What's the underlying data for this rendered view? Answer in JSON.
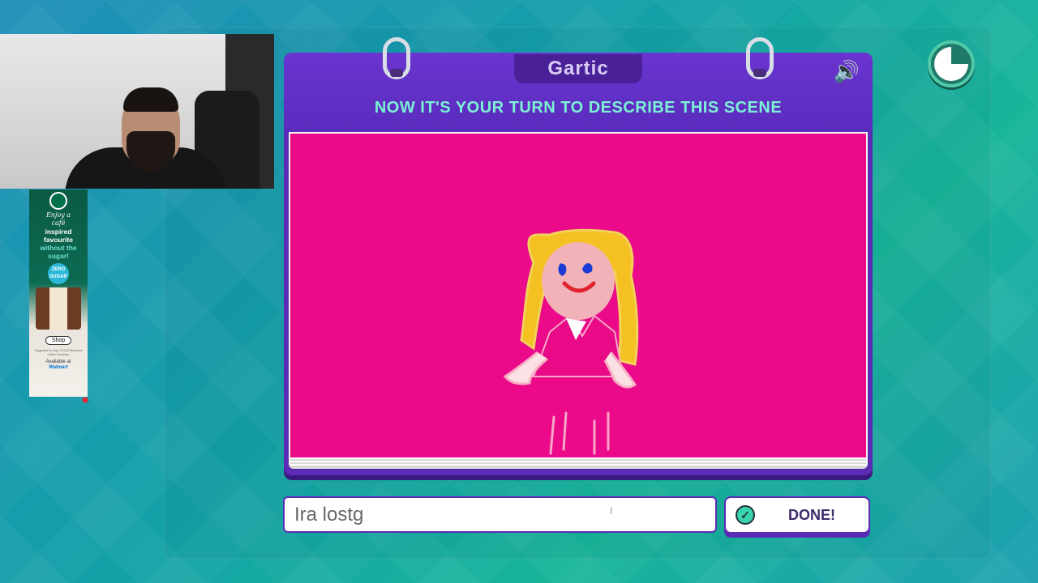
{
  "game": {
    "logo_text": "Gartic",
    "instruction": "NOW IT'S YOUR TURN TO DESCRIBE THIS SCENE",
    "sound_icon": "speaker-icon",
    "timer_icon": "timer-icon",
    "timer_remaining_fraction": 0.75
  },
  "answer": {
    "value": "Ira lostg",
    "done_label": "DONE!",
    "done_icon": "check-circle-icon"
  },
  "ad": {
    "line1": "Enjoy a",
    "line2": "café",
    "line3": "inspired",
    "line4": "favourite",
    "line5": "without the",
    "line6": "sugar!",
    "badge": "ZERO SUGAR",
    "shop_label": "Shop",
    "fine_print": "Suggested for stay. © 2024 Starbucks Coffee Company.",
    "available": "Available at",
    "retailer": "Walmart"
  },
  "colors": {
    "canvas": "#eb0a8a",
    "card": "#5b2bb5",
    "instruction": "#7cf2d4"
  }
}
